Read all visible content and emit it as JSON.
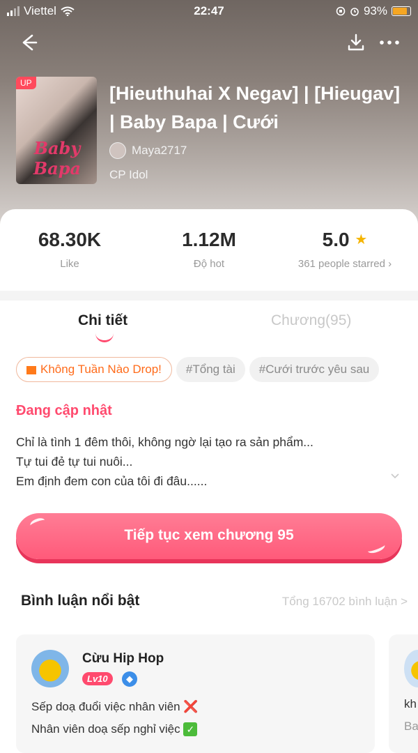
{
  "status_bar": {
    "carrier": "Viettel",
    "time": "22:47",
    "battery": "93%"
  },
  "book": {
    "cover_badge": "UP",
    "cover_text": "Baby Bapa",
    "title": "[Hieuthuhai X Negav] | [Hieugav] | Baby Bapa | Cưới",
    "author": "Maya2717",
    "category": "CP Idol"
  },
  "stats": {
    "likes": {
      "value": "68.30K",
      "label": "Like"
    },
    "hot": {
      "value": "1.12M",
      "label": "Độ hot"
    },
    "rating": {
      "value": "5.0",
      "label": "361 people starred",
      "arrow": "›"
    }
  },
  "tabs": [
    {
      "label": "Chi tiết",
      "active": true
    },
    {
      "label": "Chương(95)",
      "active": false
    }
  ],
  "tags": [
    "Không Tuần Nào Drop!",
    "#Tổng tài",
    "#Cưới trước yêu sau"
  ],
  "update_status": "Đang cập nhật",
  "synopsis": [
    "Chỉ là tình 1 đêm thôi, không ngờ lại tạo ra sản phẩm...",
    "Tự tui đẻ tự tui nuôi...",
    "Em định đem con của tôi đi đâu......"
  ],
  "continue_button": "Tiếp tục xem chương 95",
  "comments": {
    "heading": "Bình luận nổi bật",
    "total": "Tổng 16702 bình luận >",
    "items": [
      {
        "user": "Cừu Hip Hop",
        "level": "Lv10",
        "line1": "Sếp doạ đuổi việc nhân viên",
        "line1_icon": "❌",
        "line2": "Nhân viên doạ sếp nghỉ việc",
        "line2_icon": "✓"
      },
      {
        "line1": "kh",
        "line2": "Ba"
      }
    ]
  },
  "colors": {
    "accent": "#ff5a7a",
    "tag_orange": "#ff6b1a",
    "star": "#f5b400"
  }
}
